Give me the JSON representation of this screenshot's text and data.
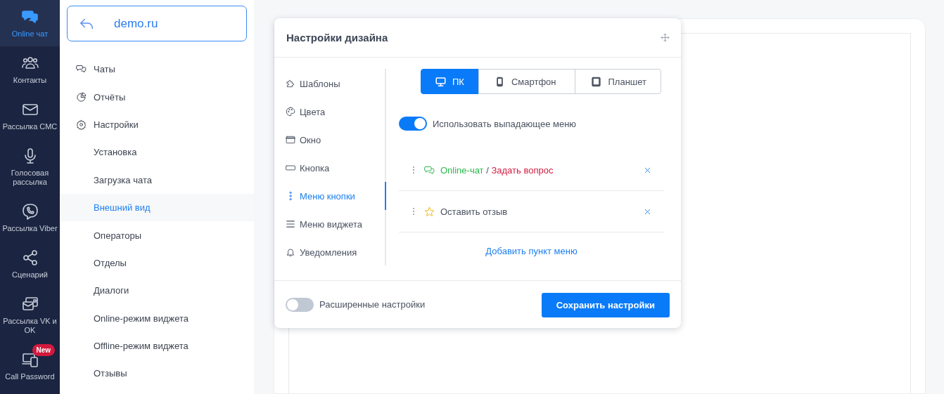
{
  "rail": [
    {
      "kind": "chat",
      "label": "Online чат",
      "selected": true
    },
    {
      "kind": "contacts",
      "label": "Контакты",
      "selected": false
    },
    {
      "kind": "mail",
      "label": "Рассылка СМС",
      "selected": false
    },
    {
      "kind": "mic",
      "label": "Голосовая рассылка",
      "selected": false
    },
    {
      "kind": "viber",
      "label": "Рассылка Viber",
      "selected": false
    },
    {
      "kind": "share",
      "label": "Сценарий",
      "selected": false
    },
    {
      "kind": "vk",
      "label": "Рассылка VK и OK",
      "selected": false
    },
    {
      "kind": "device",
      "label": "Call Password",
      "selected": false,
      "badge": "New"
    }
  ],
  "site": {
    "name": "demo.ru"
  },
  "nav": [
    {
      "kind": "chats",
      "label": "Чаты",
      "selected": false
    },
    {
      "kind": "reports",
      "label": "Отчёты",
      "selected": false
    },
    {
      "kind": "settings",
      "label": "Настройки",
      "selected": false,
      "children": [
        {
          "label": "Установка",
          "selected": false
        },
        {
          "label": "Загрузка чата",
          "selected": false
        },
        {
          "label": "Внешний вид",
          "selected": true
        },
        {
          "label": "Операторы",
          "selected": false
        },
        {
          "label": "Отделы",
          "selected": false
        },
        {
          "label": "Диалоги",
          "selected": false
        },
        {
          "label": "Online-режим виджета",
          "selected": false
        },
        {
          "label": "Offline-режим виджета",
          "selected": false
        },
        {
          "label": "Отзывы",
          "selected": false
        }
      ]
    }
  ],
  "dialog": {
    "title": "Настройки дизайна",
    "sections": [
      {
        "kind": "puzzle",
        "label": "Шаблоны",
        "selected": false
      },
      {
        "kind": "palette",
        "label": "Цвета",
        "selected": false
      },
      {
        "kind": "window",
        "label": "Окно",
        "selected": false
      },
      {
        "kind": "button",
        "label": "Кнопка",
        "selected": false
      },
      {
        "kind": "dots",
        "label": "Меню кнопки",
        "selected": true
      },
      {
        "kind": "lines",
        "label": "Меню виджета",
        "selected": false
      },
      {
        "kind": "bell",
        "label": "Уведомления",
        "selected": false
      }
    ],
    "devices": [
      {
        "kind": "pc",
        "label": "ПК",
        "selected": true
      },
      {
        "kind": "phone",
        "label": "Смартфон",
        "selected": false
      },
      {
        "kind": "tablet",
        "label": "Планшет",
        "selected": false
      }
    ],
    "dropdown_toggle": {
      "label": "Использовать выпадающее меню",
      "on": true
    },
    "menu_items": [
      {
        "kind": "chat",
        "title": "Online-чат",
        "separator": "/",
        "alt": "Задать вопрос"
      },
      {
        "kind": "star",
        "title": "Оставить отзыв"
      }
    ],
    "add_link": "Добавить пункт меню",
    "advanced_toggle": {
      "label": "Расширенные настройки",
      "on": false
    },
    "save_button": "Сохранить настройки"
  }
}
